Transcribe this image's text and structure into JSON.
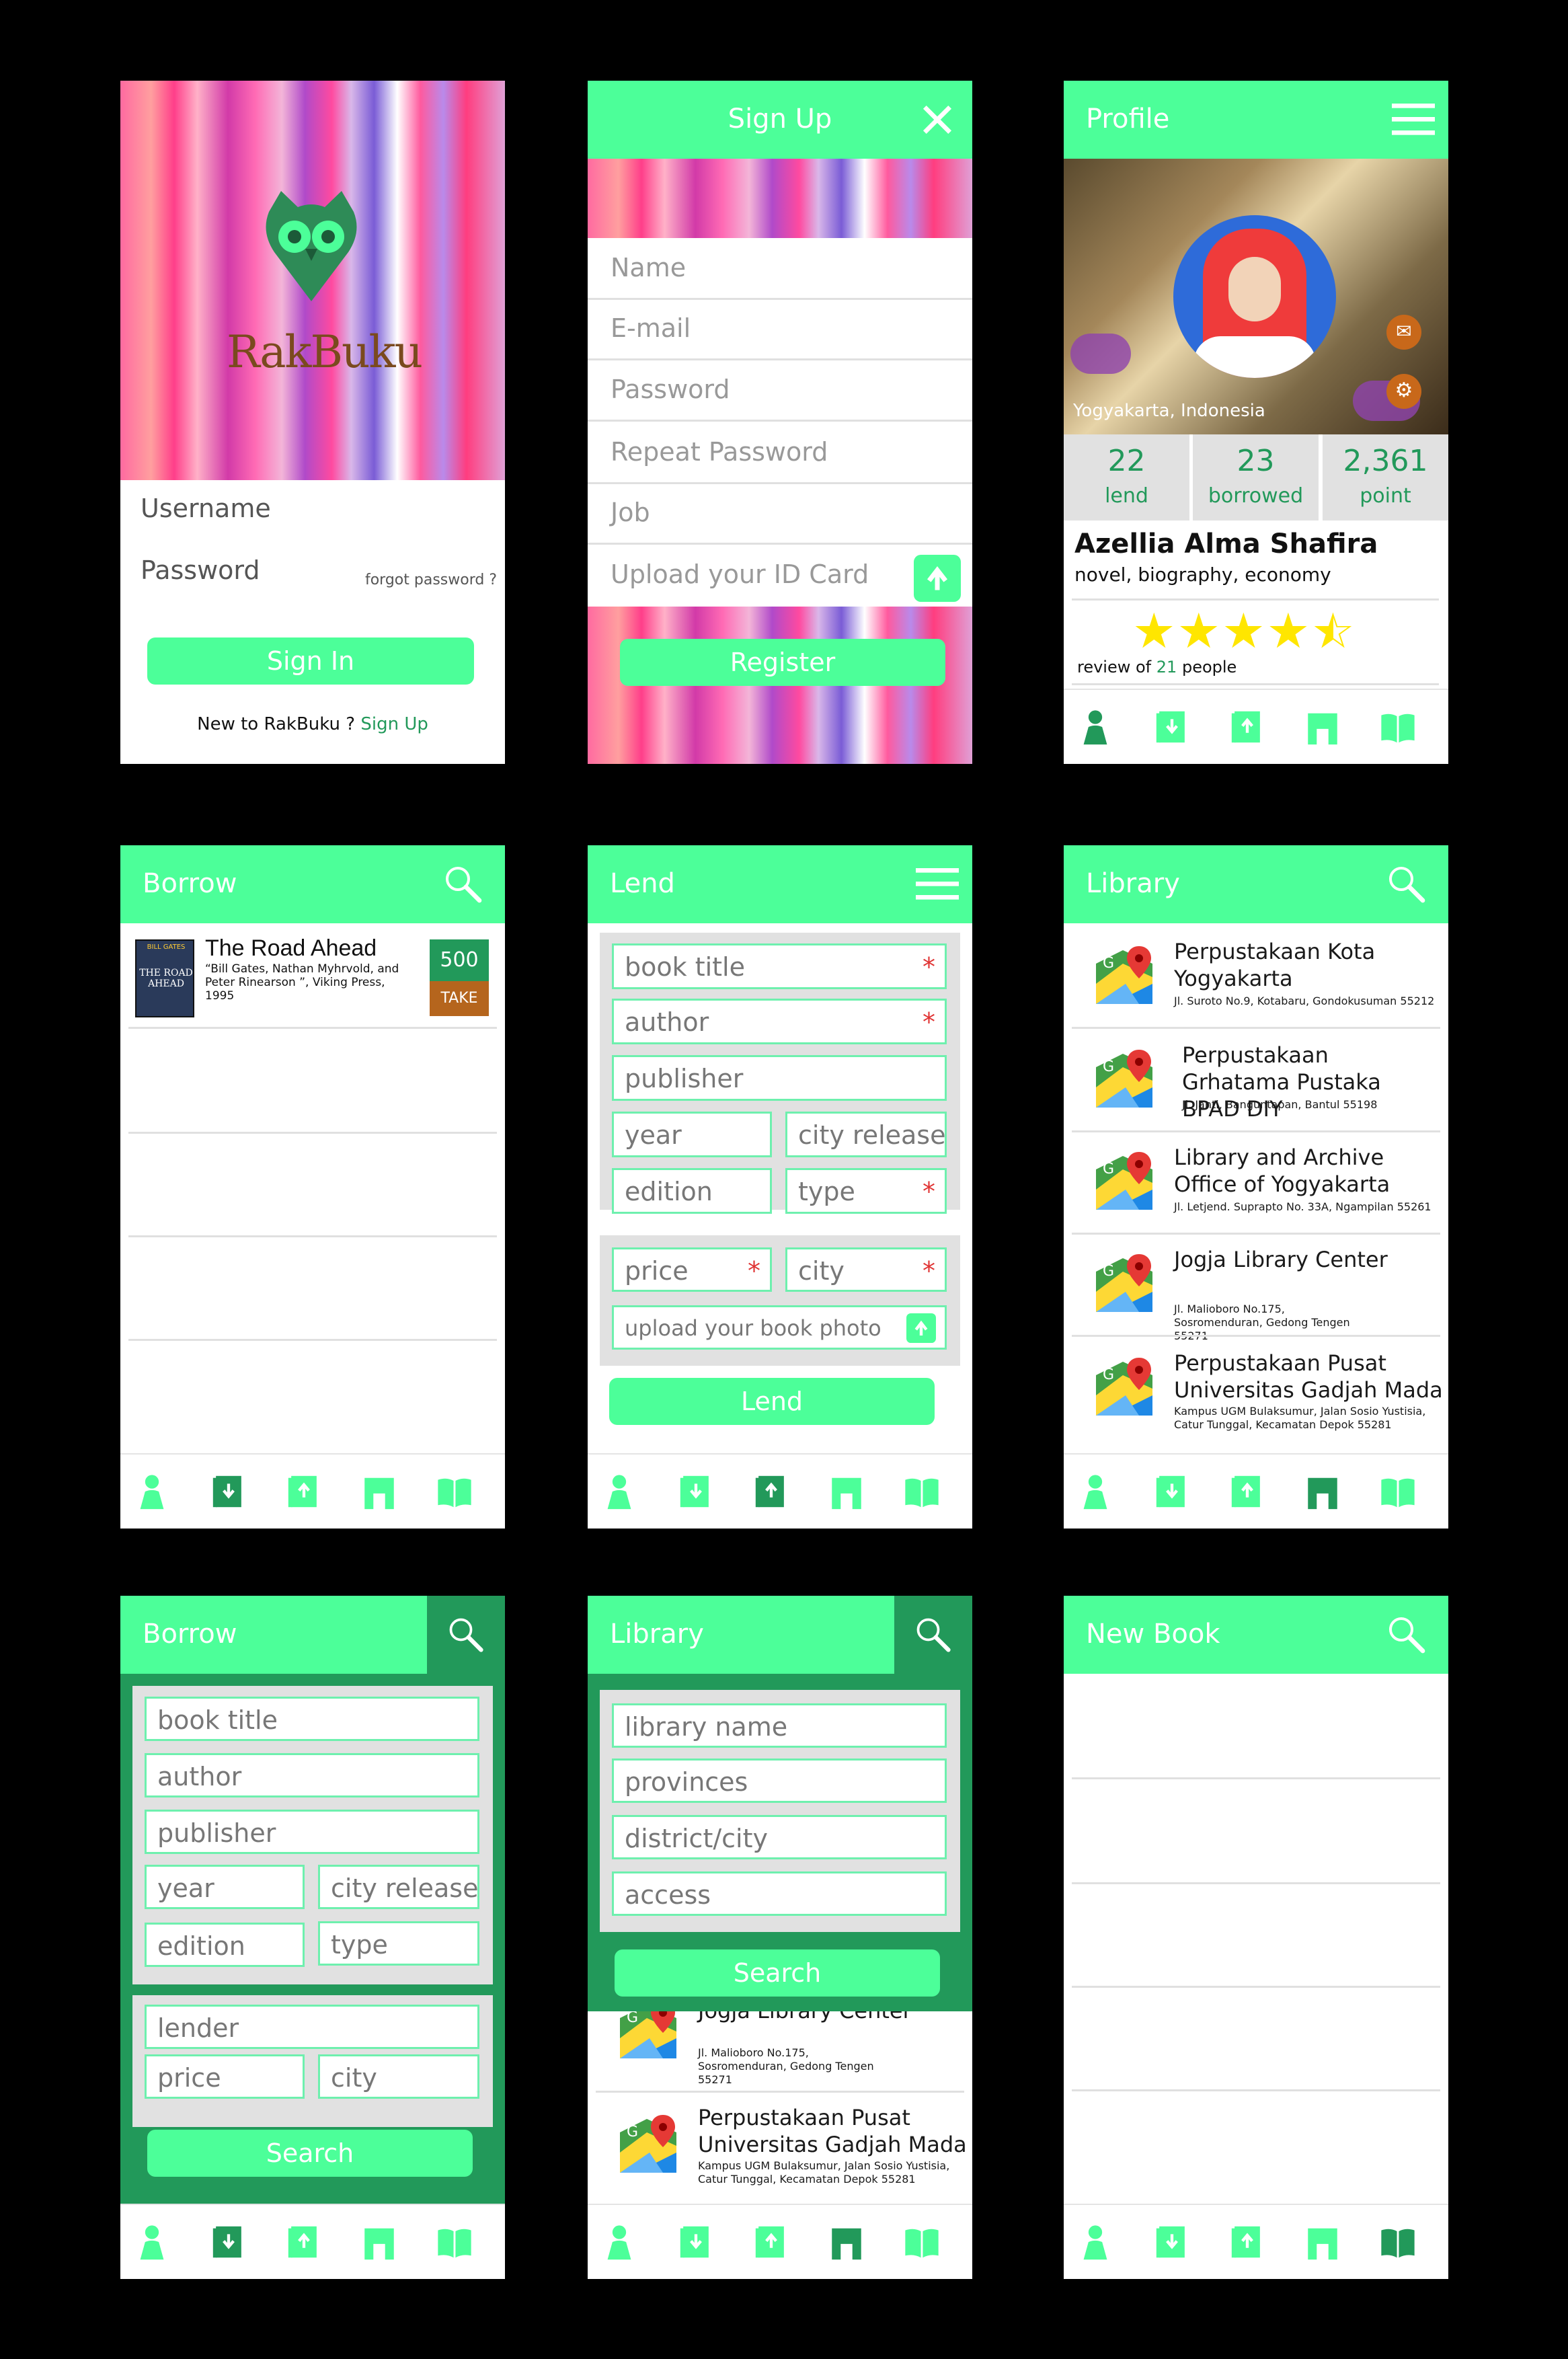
{
  "colors": {
    "accent": "#4cff99",
    "dark_accent": "#22995a",
    "required": "#e03333",
    "star": "#ffe600",
    "orange": "#c8681a"
  },
  "login": {
    "logo_text": "RakBuku",
    "username_placeholder": "Username",
    "password_placeholder": "Password",
    "forgot": "forgot password ?",
    "signin": "Sign In",
    "new_text": "New to RakBuku ?",
    "signup_link": "Sign Up"
  },
  "signup": {
    "title": "Sign Up",
    "fields": [
      "Name",
      "E-mail",
      "Password",
      "Repeat Password",
      "Job",
      "Upload your ID Card"
    ],
    "register": "Register",
    "close_icon": "close-icon",
    "upload_icon": "upload-icon"
  },
  "profile": {
    "title": "Profile",
    "location": "Yogyakarta, Indonesia",
    "stats": [
      {
        "value": "22",
        "label": "lend"
      },
      {
        "value": "23",
        "label": "borrowed"
      },
      {
        "value": "2,361",
        "label": "point"
      }
    ],
    "name": "Azellia Alma Shafira",
    "interests": "novel, biography, economy",
    "rating": 4.5,
    "review_prefix": "review of",
    "review_count": "21",
    "review_suffix": "people"
  },
  "borrow_list": {
    "title": "Borrow",
    "book": {
      "title": "The Road Ahead",
      "meta": "“Bill Gates, Nathan Myhrvold, and Peter Rinearson ”, Viking Press, 1995",
      "cover_author": "BILL GATES",
      "cover_title": "THE ROAD AHEAD",
      "price": "500",
      "action": "TAKE"
    }
  },
  "lend": {
    "title": "Lend",
    "fields": {
      "book_title": "book title",
      "author": "author",
      "publisher": "publisher",
      "year": "year",
      "city_release": "city release",
      "edition": "edition",
      "type": "type",
      "price": "price",
      "city": "city",
      "photo": "upload your book photo"
    },
    "required_mark": "*",
    "button": "Lend"
  },
  "library_list": {
    "title": "Library",
    "items": [
      {
        "name": "Perpustakaan Kota Yogyakarta",
        "address": "Jl. Suroto No.9, Kotabaru, Gondokusuman 55212"
      },
      {
        "name": "Perpustakaan Grhatama Pustaka BPAD DIY",
        "address": "Jl. Janti, Banguntapan, Bantul 55198"
      },
      {
        "name": "Library and Archive Office of Yogyakarta",
        "address": "Jl. Letjend. Suprapto No. 33A, Ngampilan 55261"
      },
      {
        "name": "Jogja Library Center",
        "address": "Jl. Malioboro No.175, Sosromenduran, Gedong Tengen 55271"
      },
      {
        "name": "Perpustakaan Pusat Universitas Gadjah Mada",
        "address": "Kampus UGM Bulaksumur, Jalan Sosio Yustisia, Catur Tunggal, Kecamatan Depok 55281"
      }
    ]
  },
  "borrow_search": {
    "title": "Borrow",
    "fields": {
      "book_title": "book title",
      "author": "author",
      "publisher": "publisher",
      "year": "year",
      "city_release": "city release",
      "edition": "edition",
      "type": "type",
      "lender": "lender",
      "price": "price",
      "city": "city"
    },
    "button": "Search"
  },
  "library_search": {
    "title": "Library",
    "fields": {
      "library_name": "library name",
      "provinces": "provinces",
      "district": "district/city",
      "access": "access"
    },
    "button": "Search",
    "results": [
      {
        "name": "Jogja Library Center",
        "address": "Jl. Malioboro No.175, Sosromenduran, Gedong Tengen 55271"
      },
      {
        "name": "Perpustakaan Pusat Universitas Gadjah Mada",
        "address": "Kampus UGM Bulaksumur, Jalan Sosio Yustisia, Catur Tunggal, Kecamatan Depok 55281"
      }
    ]
  },
  "new_book": {
    "title": "New Book"
  },
  "nav_icons": [
    "profile-icon",
    "borrow-book-icon",
    "lend-book-icon",
    "library-icon",
    "new-book-icon"
  ]
}
